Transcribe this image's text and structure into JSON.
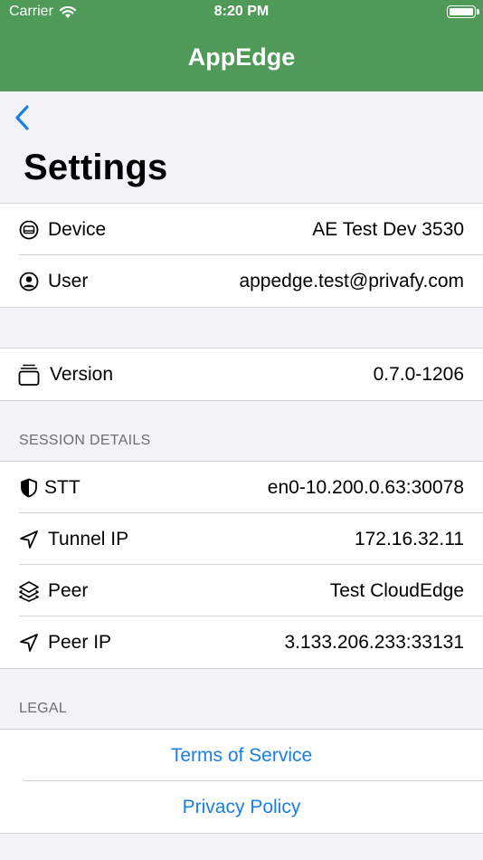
{
  "status_bar": {
    "carrier": "Carrier",
    "time": "8:20 PM"
  },
  "header": {
    "title": "AppEdge"
  },
  "page": {
    "title": "Settings"
  },
  "account": [
    {
      "icon": "device-icon",
      "label": "Device",
      "value": "AE Test Dev 3530"
    },
    {
      "icon": "user-icon",
      "label": "User",
      "value": "appedge.test@privafy.com"
    }
  ],
  "about": [
    {
      "icon": "version-stack-icon",
      "label": "Version",
      "value": "0.7.0-1206"
    }
  ],
  "session": {
    "header": "SESSION DETAILS",
    "rows": [
      {
        "icon": "shield-icon",
        "label": "STT",
        "value": "en0-10.200.0.63:30078"
      },
      {
        "icon": "location-arrow-icon",
        "label": "Tunnel IP",
        "value": "172.16.32.11"
      },
      {
        "icon": "layers-icon",
        "label": "Peer",
        "value": "Test CloudEdge"
      },
      {
        "icon": "location-arrow-icon",
        "label": "Peer IP",
        "value": "3.133.206.233:33131"
      }
    ]
  },
  "legal": {
    "header": "LEGAL",
    "links": [
      {
        "label": "Terms of Service"
      },
      {
        "label": "Privacy Policy"
      }
    ]
  },
  "colors": {
    "header_bg": "#4f9a58",
    "link": "#1a7fe5",
    "back_chevron": "#1a7fe5"
  }
}
